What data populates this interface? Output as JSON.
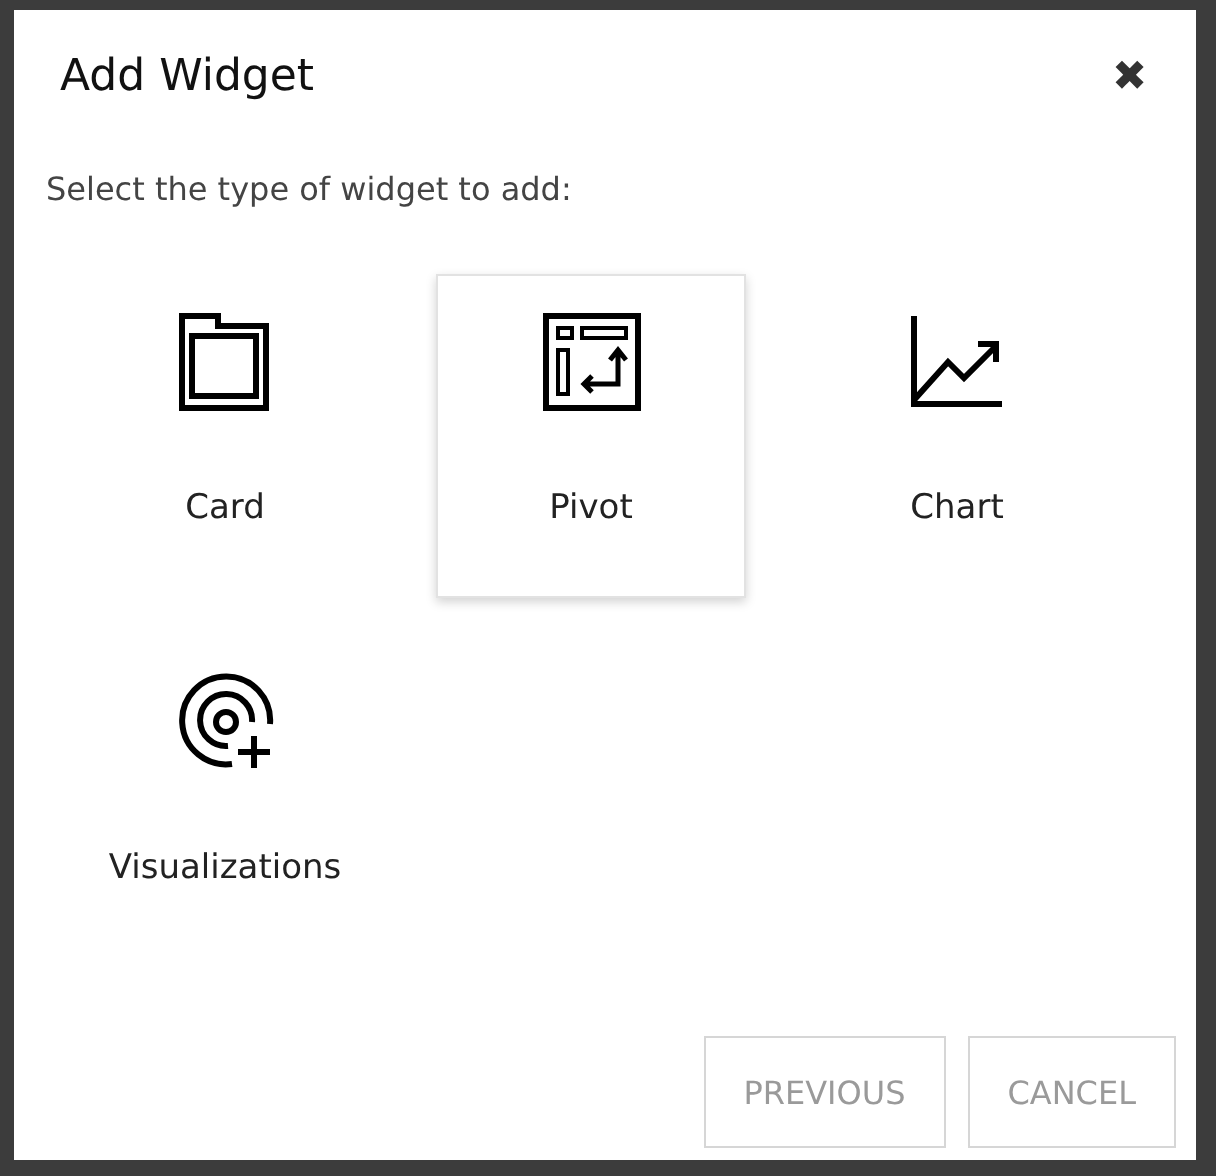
{
  "dialog": {
    "title": "Add Widget",
    "close": "✖",
    "prompt": "Select the type of widget to add:"
  },
  "widget_types": [
    {
      "kind": "card",
      "label": "Card",
      "hovered": false
    },
    {
      "kind": "pivot",
      "label": "Pivot",
      "hovered": true
    },
    {
      "kind": "chart",
      "label": "Chart",
      "hovered": false
    },
    {
      "kind": "visualizations",
      "label": "Visualizations",
      "hovered": false
    }
  ],
  "buttons": [
    "PREVIOUS",
    "CANCEL"
  ]
}
